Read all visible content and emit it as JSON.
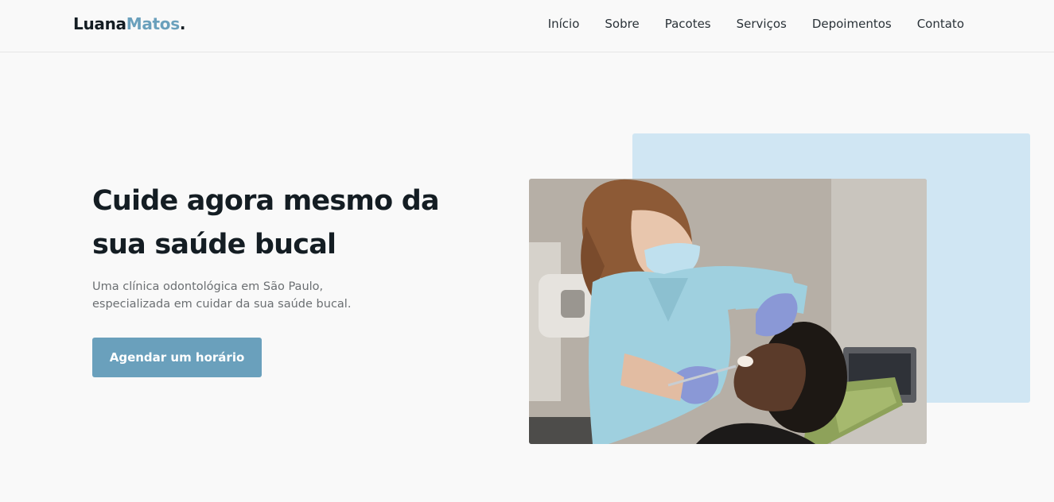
{
  "header": {
    "logo_main": "Luana",
    "logo_accent": "Matos",
    "logo_dot": ".",
    "nav": [
      "Início",
      "Sobre",
      "Pacotes",
      "Serviços",
      "Depoimentos",
      "Contato"
    ]
  },
  "hero": {
    "title": "Cuide agora mesmo da sua saúde bucal",
    "text": "Uma clínica odontológica em São Paulo, especializada em cuidar da sua saúde bucal.",
    "cta_label": "Agendar um horário"
  },
  "colors": {
    "accent": "#6aa0bc",
    "accent_light": "#d0e6f3",
    "text_dark": "#141d23",
    "background": "#f9f9f9"
  }
}
